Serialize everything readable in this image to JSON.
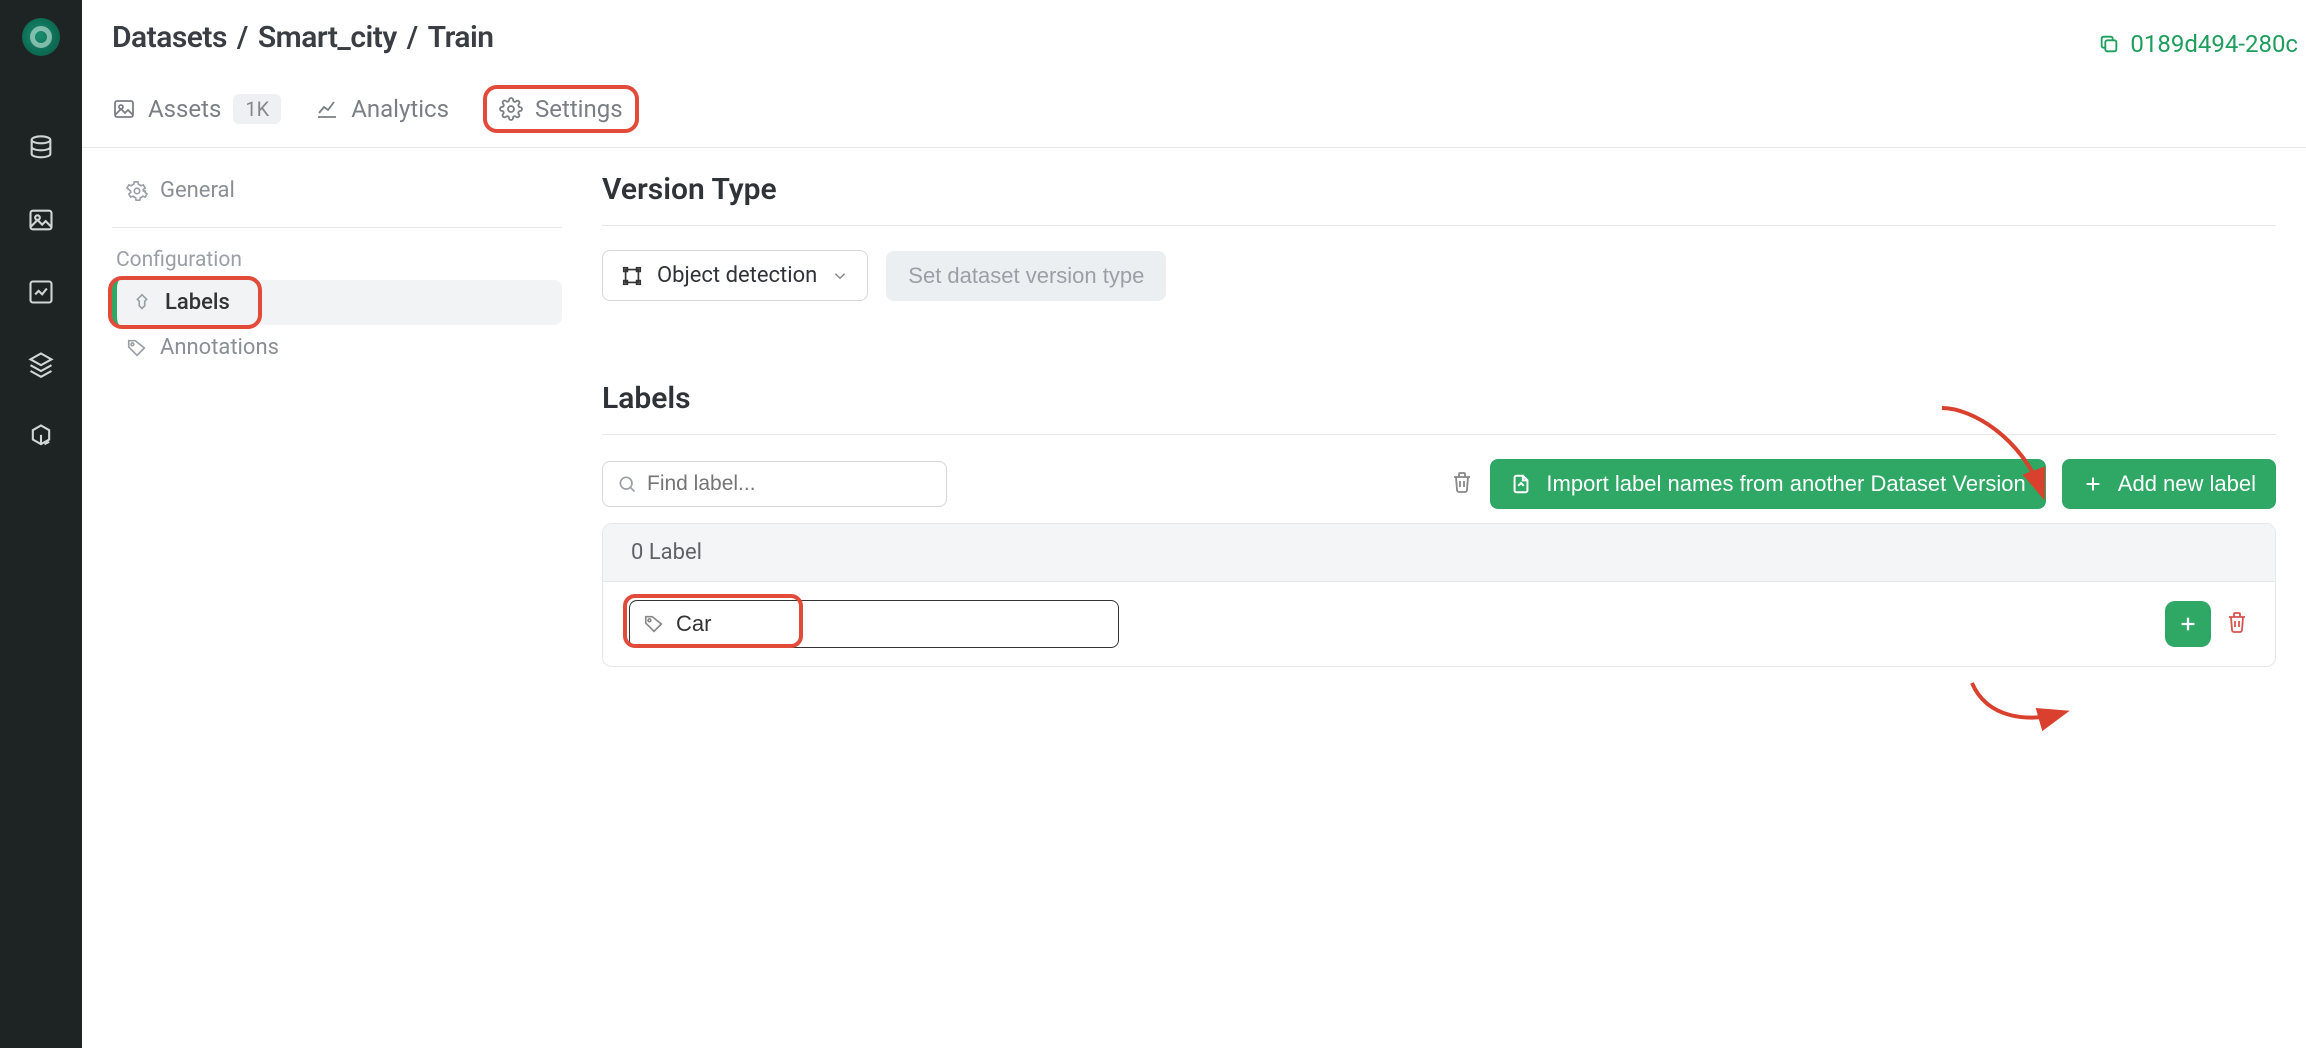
{
  "breadcrumbs": {
    "root": "Datasets",
    "dataset": "Smart_city",
    "version": "Train"
  },
  "version_id": "0189d494-280c",
  "tabs": {
    "assets": {
      "label": "Assets",
      "badge": "1K"
    },
    "analytics": {
      "label": "Analytics"
    },
    "settings": {
      "label": "Settings"
    }
  },
  "settings_nav": {
    "general": "General",
    "category": "Configuration",
    "labels": "Labels",
    "annotations": "Annotations"
  },
  "content": {
    "version_type_title": "Version Type",
    "vt_select_value": "Object detection",
    "vt_set_btn": "Set dataset version type",
    "labels_title": "Labels",
    "search_placeholder": "Find label...",
    "import_btn": "Import label names from another Dataset Version",
    "add_btn": "Add new label",
    "count_label": "0 Label",
    "row_input_value": "Car"
  }
}
